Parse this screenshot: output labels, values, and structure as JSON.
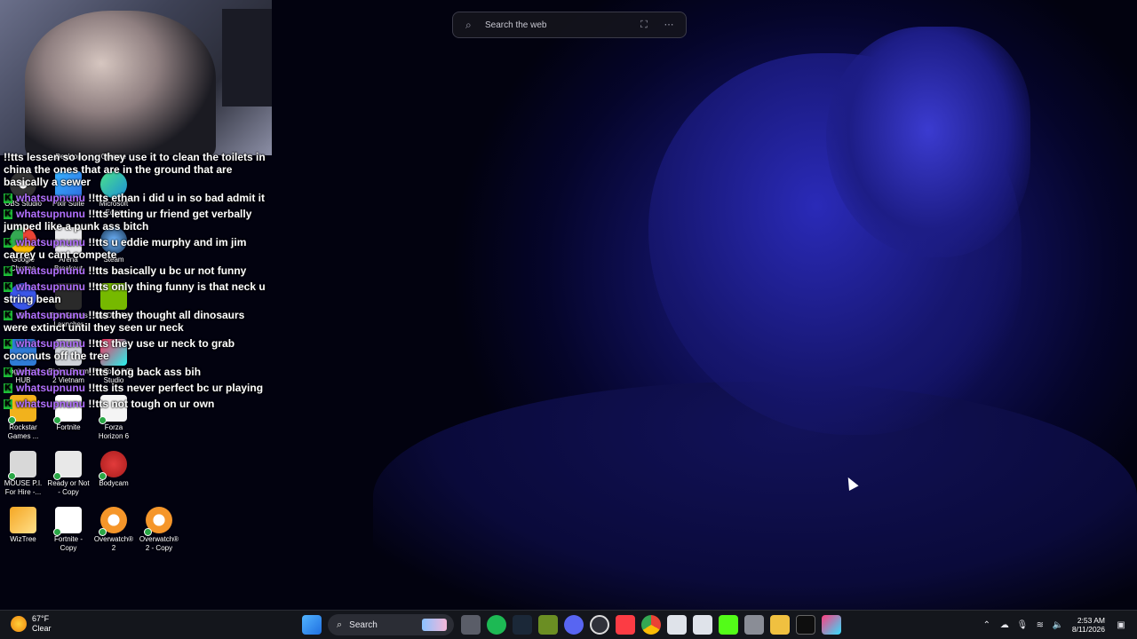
{
  "search_widget": {
    "placeholder": "Search the web"
  },
  "desktop_icons": [
    {
      "label": "Desktop"
    },
    {
      "label": "Chrome"
    },
    {
      "label": "OBS Studio"
    },
    {
      "label": "Pixlr Suite"
    },
    {
      "label": "Microsoft Edge"
    },
    {
      "label": "Google Chrome"
    },
    {
      "label": "Arena Breakout"
    },
    {
      "label": "Steam"
    },
    {
      "label": "EA"
    },
    {
      "label": "Epic Games Launcher"
    },
    {
      "label": "NVIDIA App"
    },
    {
      "label": "Logitech G HUB"
    },
    {
      "label": "Rising Storm 2 Vietnam"
    },
    {
      "label": "TikTok LIVE Studio"
    },
    {
      "label": "Rockstar Games ..."
    },
    {
      "label": "Fortnite"
    },
    {
      "label": "Forza Horizon 6"
    },
    {
      "label": "MOUSE P.I. For Hire -..."
    },
    {
      "label": "Ready or Not - Copy"
    },
    {
      "label": "Bodycam"
    },
    {
      "label": "WizTree"
    },
    {
      "label": "Fortnite - Copy"
    },
    {
      "label": "Overwatch® 2"
    },
    {
      "label": "Overwatch® 2 - Copy"
    }
  ],
  "chat": {
    "messages": [
      {
        "user": "",
        "text": "!!tts lessen so long they use it to clean the toilets in china the ones that are in the ground that are basically a sewer"
      },
      {
        "user": "whatsupnunu",
        "text": "!!tts ethan i did u in so bad admit it"
      },
      {
        "user": "whatsupnunu",
        "text": "!!tts letting ur friend get verbally jumped like a punk ass bitch"
      },
      {
        "user": "whatsupnunu",
        "text": "!!tts u eddie murphy and im jim carrey u cant compete"
      },
      {
        "user": "whatsupnunu",
        "text": "!!tts basically u bc ur not funny"
      },
      {
        "user": "whatsupnunu",
        "text": "!!tts only thing funny is that neck u string bean"
      },
      {
        "user": "whatsupnunu",
        "text": "!!tts they thought all dinosaurs were extinct until they seen ur neck"
      },
      {
        "user": "whatsupnunu",
        "text": "!!tts they use ur neck to grab coconuts off the tree"
      },
      {
        "user": "whatsupnunu",
        "text": "!!tts long back ass bih"
      },
      {
        "user": "whatsupnunu",
        "text": "!!tts its never perfect bc ur playing"
      },
      {
        "user": "whatsupnunu",
        "text": "!!tts not tough on ur own"
      }
    ]
  },
  "taskbar": {
    "weather_temp": "67°F",
    "weather_cond": "Clear",
    "search_label": "Search",
    "time": "2:53 AM",
    "date": "8/11/2026"
  }
}
